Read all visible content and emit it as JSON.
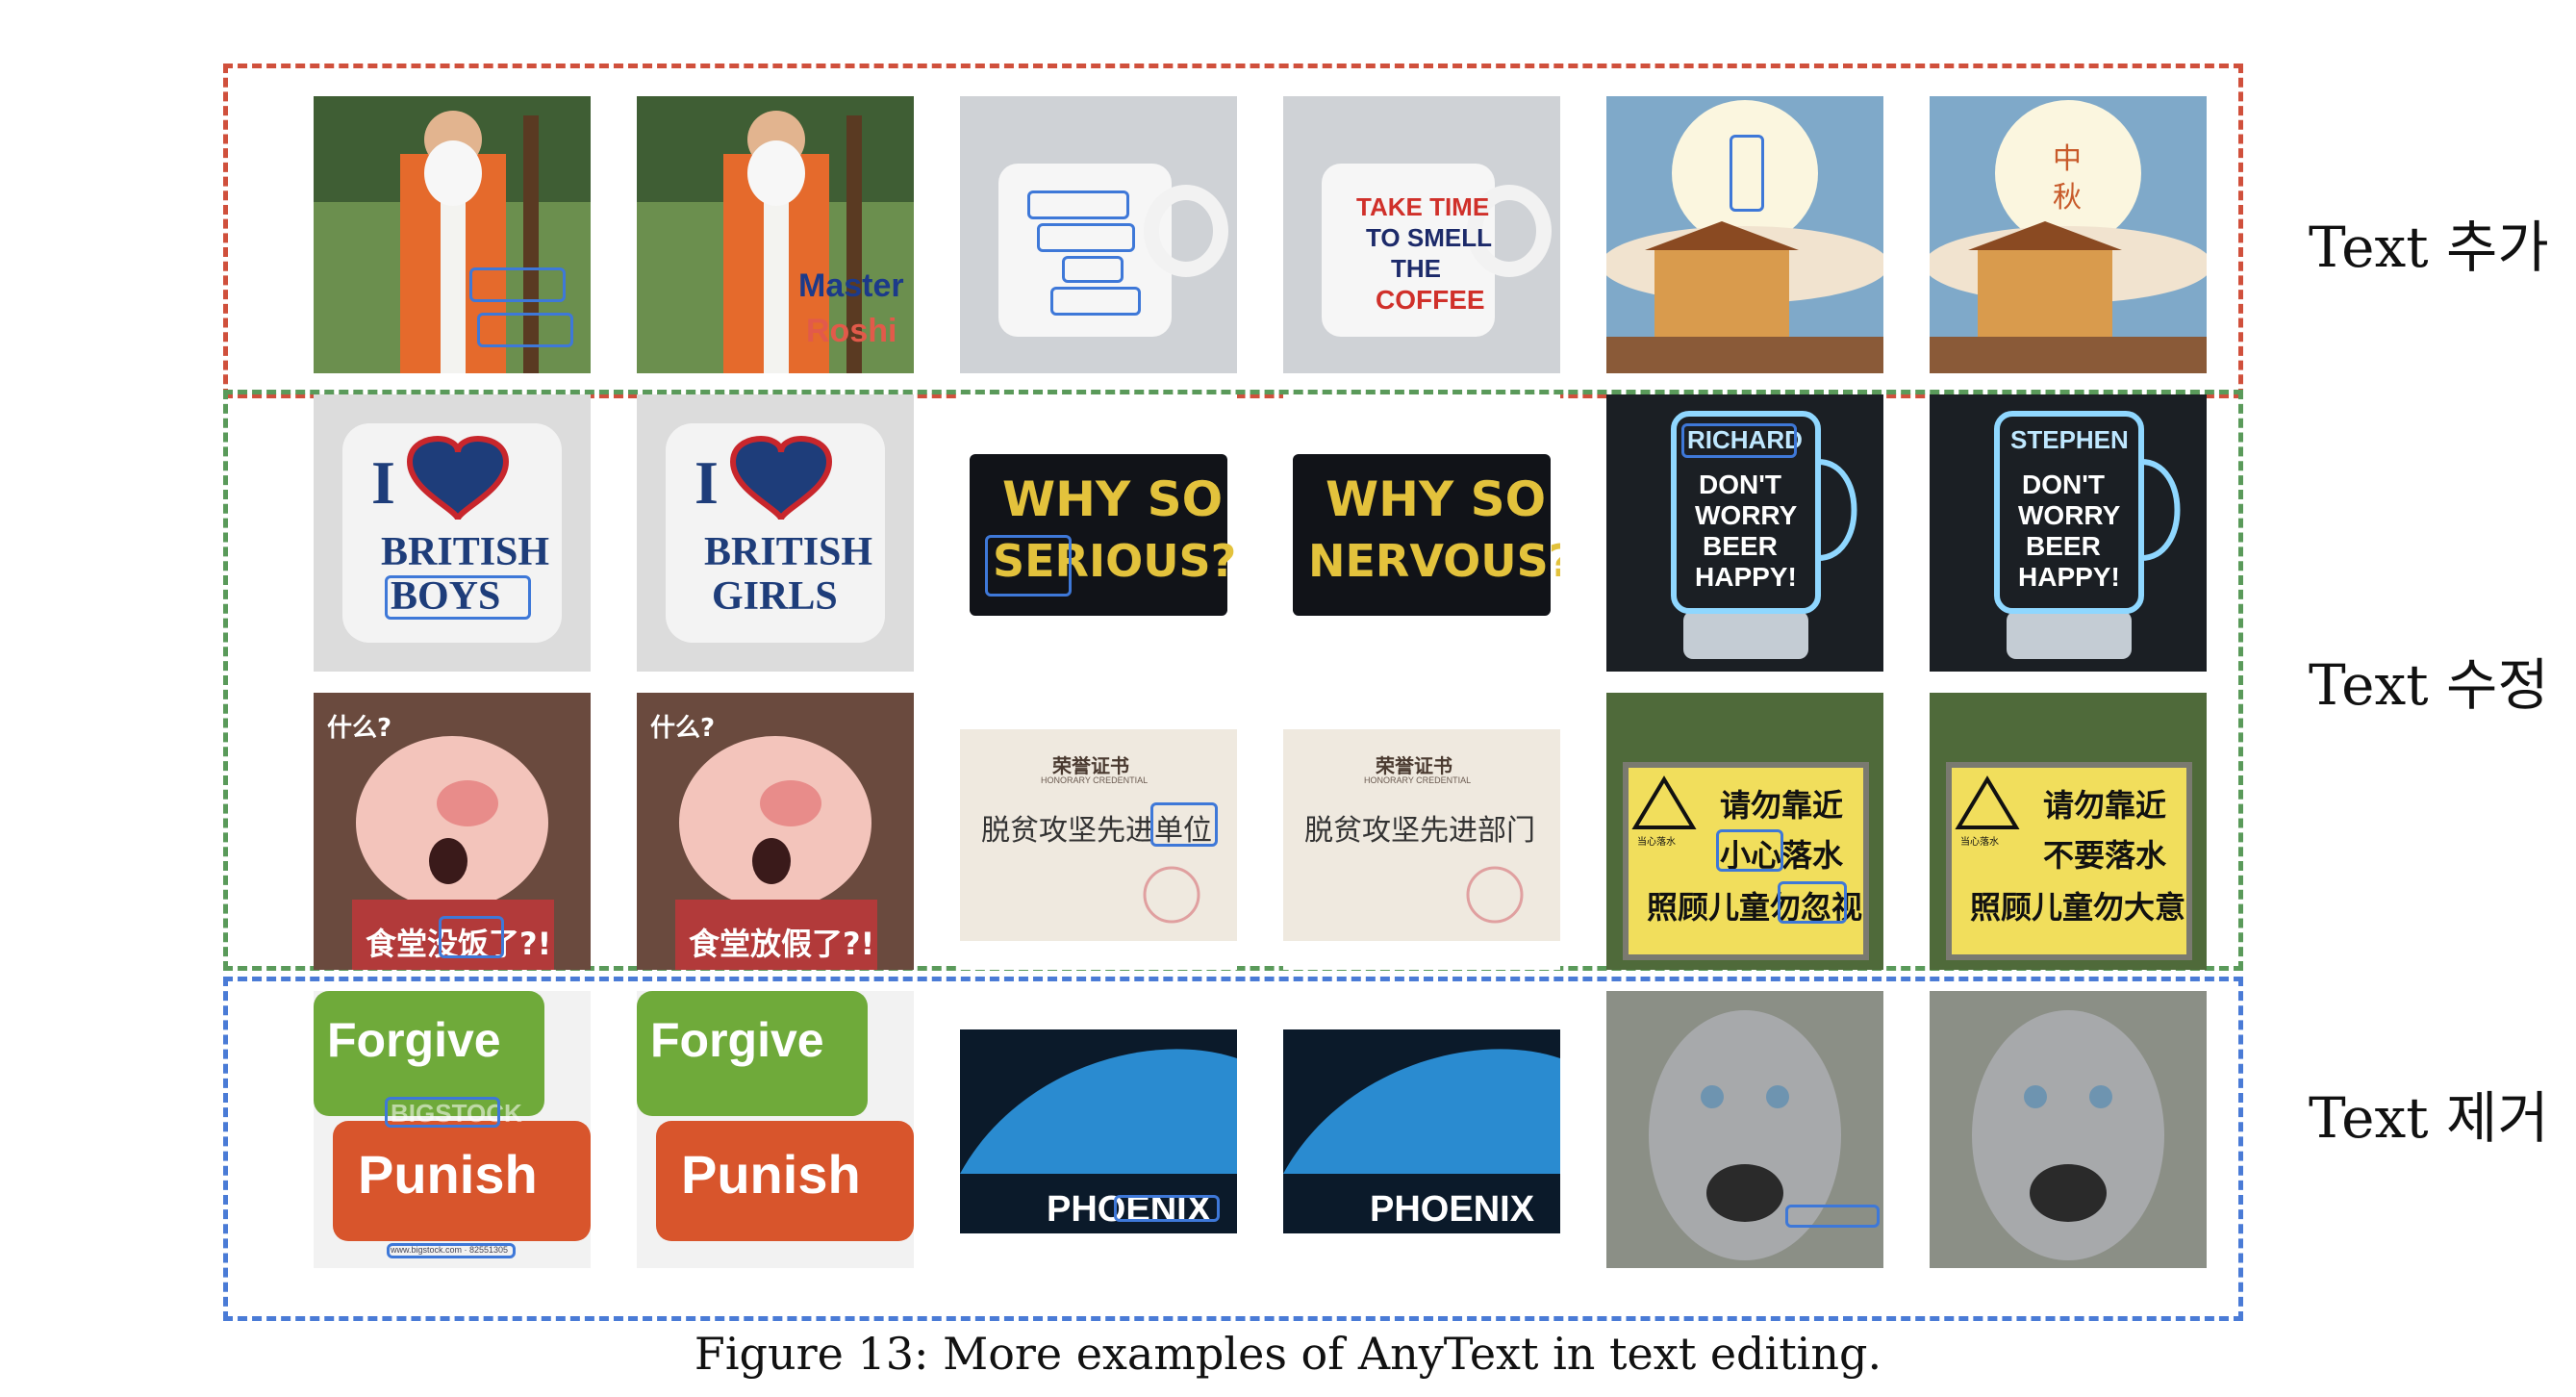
{
  "rows": {
    "add": "Text 추가",
    "modify": "Text 수정",
    "remove": "Text 제거"
  },
  "caption": "Figure 13: More examples of AnyText in text editing.",
  "examples": {
    "roshi_after": [
      "Master",
      "Roshi"
    ],
    "mug_after": [
      "TAKE TIME",
      "TO SMELL",
      "THE",
      "COFFEE"
    ],
    "lantern_after": [
      "中",
      "秋"
    ],
    "pillow_top": "I",
    "pillow_before": [
      "BRITISH",
      "BOYS"
    ],
    "pillow_after": [
      "BRITISH",
      "GIRLS"
    ],
    "patch_top": "WHY SO",
    "patch_before": "SERIOUS?",
    "patch_after": "NERVOUS?",
    "mug_light_before": "RICHARD",
    "mug_light_after": "STEPHEN",
    "mug_light_lines": [
      "DON'T",
      "WORRY",
      "BEER",
      "HAPPY!"
    ],
    "pig_top": "什么?",
    "pig_before": "食堂没饭了?!",
    "pig_after": "食堂放假了?!",
    "cert_title": "荣誉证书",
    "cert_sub": "HONORARY CREDENTIAL",
    "cert_before": "脱贫攻坚先进单位",
    "cert_after": "脱贫攻坚先进部门",
    "sign_small": "当心落水",
    "sign_before": [
      "请勿靠近",
      "小心落水",
      "照顾儿童勿忽视"
    ],
    "sign_after": [
      "请勿靠近",
      "不要落水",
      "照顾儿童勿大意"
    ],
    "key_top": "Forgive",
    "key_bottom": "Punish",
    "key_watermark": "BIGSTOCK",
    "key_url": "www.bigstock.com · 82551305",
    "phoenix": "PHOENIX"
  }
}
